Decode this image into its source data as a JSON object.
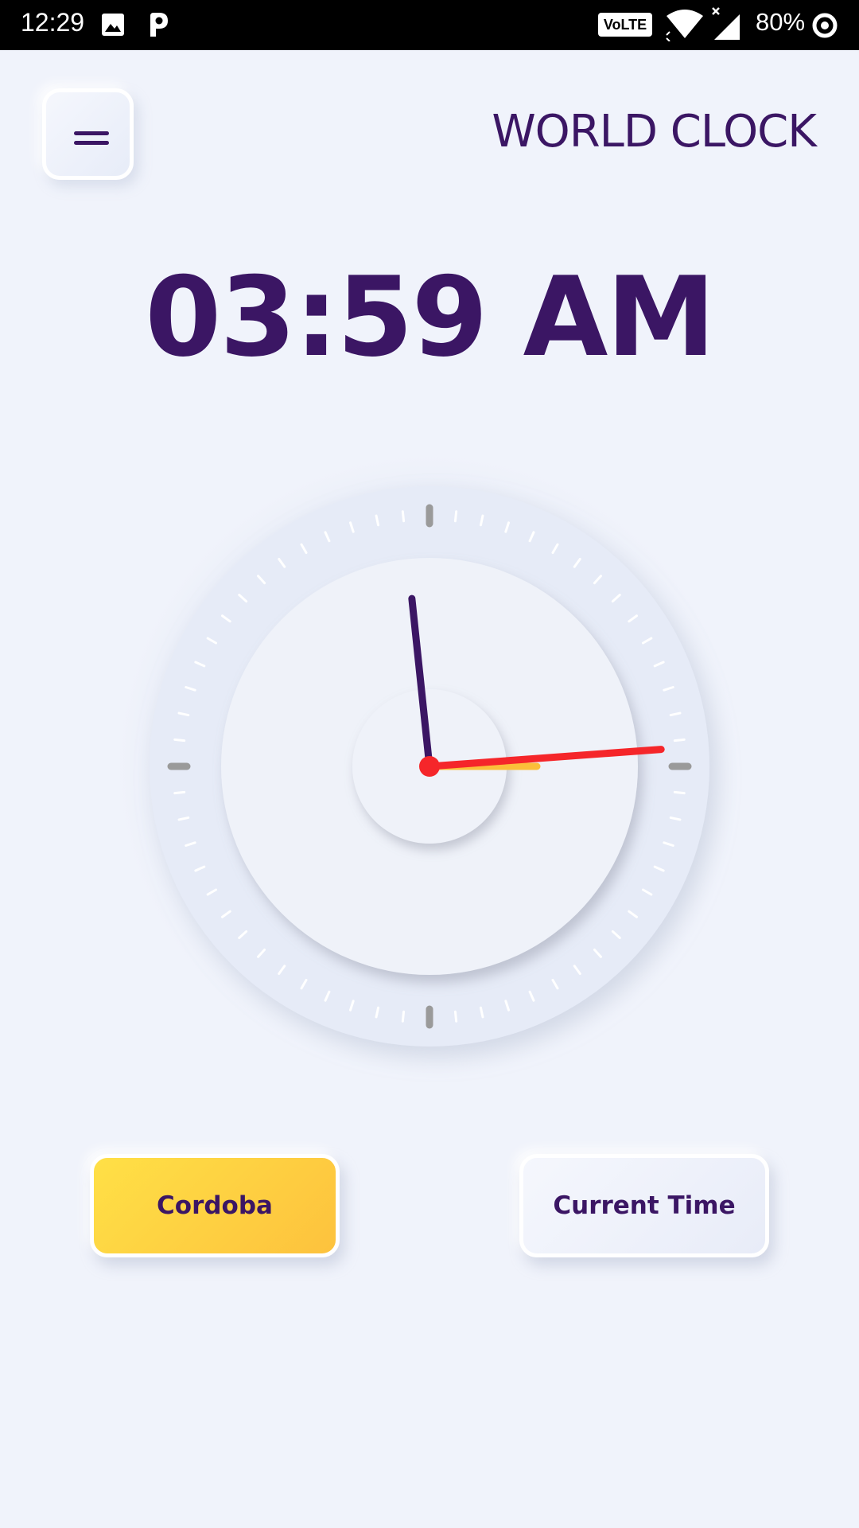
{
  "status_bar": {
    "time": "12:29",
    "volte_label": "VoLTE",
    "battery": "80%",
    "icons": [
      "image-icon",
      "p-icon",
      "volte-icon",
      "wifi-icon",
      "signal-icon",
      "battery-icon"
    ]
  },
  "header": {
    "menu_icon": "menu-icon",
    "title": "WORLD CLOCK"
  },
  "clock": {
    "digital_time": "03:59 AM",
    "hours": 3,
    "minutes": 59,
    "seconds": 14.3
  },
  "buttons": {
    "city_label": "Cordoba",
    "current_label": "Current Time"
  },
  "colors": {
    "background": "#f0f3fb",
    "text": "#3b1664",
    "accent_yellow": "#fdc23d",
    "second_hand": "#f5262a",
    "hour_hand": "#fbbf3a",
    "minute_hand": "#3b1664"
  }
}
